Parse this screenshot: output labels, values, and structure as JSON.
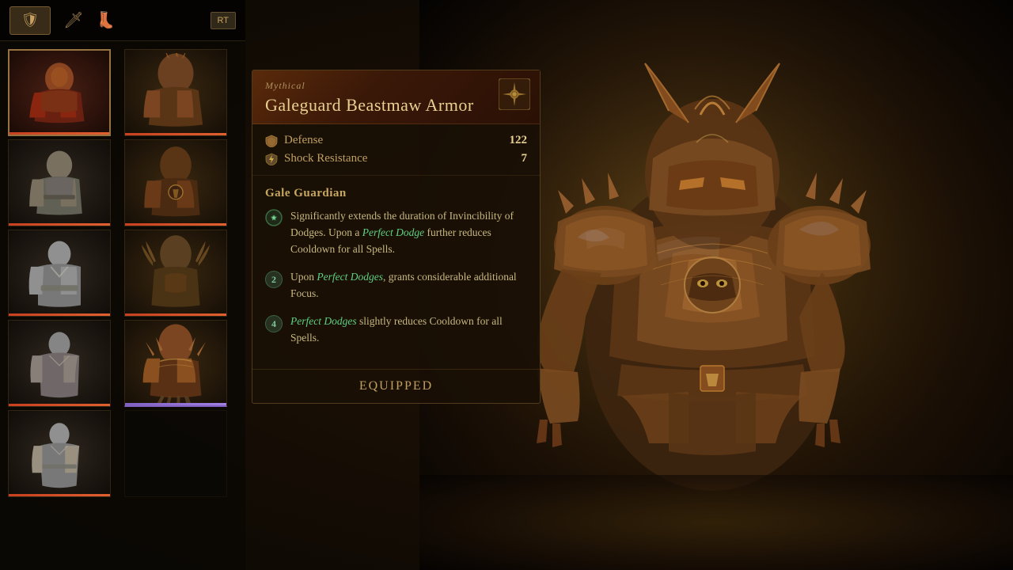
{
  "nav": {
    "icon_armor": "🛡",
    "icon_weapon": "🗡",
    "icon_boots": "👢",
    "button_label": "RT"
  },
  "item_panel": {
    "title": "Galeguard Beastmaw Armor",
    "rarity": "Mythical",
    "emblem": "⚔",
    "stats": [
      {
        "label": "Defense",
        "icon": "🛡",
        "value": "122"
      },
      {
        "label": "Shock Resistance",
        "icon": "⚡",
        "value": "7"
      }
    ],
    "ability_section_title": "Gale Guardian",
    "abilities": [
      {
        "type": "icon",
        "icon": "✦",
        "text_parts": [
          {
            "text": "Significantly extends the duration of Invincibility of Dodges. Upon a ",
            "highlight": false
          },
          {
            "text": "Perfect Dodge",
            "highlight": true
          },
          {
            "text": " further reduces Cooldown for all Spells.",
            "highlight": false
          }
        ]
      },
      {
        "type": "num",
        "num": "2",
        "text_parts": [
          {
            "text": "Upon ",
            "highlight": false
          },
          {
            "text": "Perfect Dodges",
            "highlight": true
          },
          {
            "text": ", grants considerable additional Focus.",
            "highlight": false
          }
        ]
      },
      {
        "type": "num",
        "num": "4",
        "text_parts": [
          {
            "text": "Perfect Dodges",
            "highlight": true
          },
          {
            "text": " slightly reduces Cooldown for all Spells.",
            "highlight": false
          }
        ]
      }
    ],
    "footer_label": "Equipped"
  },
  "grid_items": [
    {
      "id": 1,
      "emoji": "🧥",
      "color": "red",
      "selected": true,
      "bar": "orange"
    },
    {
      "id": 2,
      "emoji": "🪖",
      "color": "brown",
      "selected": false,
      "bar": "orange"
    },
    {
      "id": 3,
      "emoji": "🦺",
      "color": "gray",
      "selected": false,
      "bar": "orange"
    },
    {
      "id": 4,
      "emoji": "🧤",
      "color": "brown",
      "selected": false,
      "bar": "orange"
    },
    {
      "id": 5,
      "emoji": "👘",
      "color": "gray",
      "selected": false,
      "bar": "orange"
    },
    {
      "id": 6,
      "emoji": "🦣",
      "color": "brown",
      "selected": false,
      "bar": "orange"
    },
    {
      "id": 7,
      "emoji": "🥻",
      "color": "gray",
      "selected": false,
      "bar": "orange"
    },
    {
      "id": 8,
      "emoji": "🌿",
      "color": "brown",
      "selected": false,
      "bar": "purple"
    },
    {
      "id": 9,
      "emoji": "👔",
      "color": "gray",
      "selected": false,
      "bar": "orange"
    }
  ]
}
